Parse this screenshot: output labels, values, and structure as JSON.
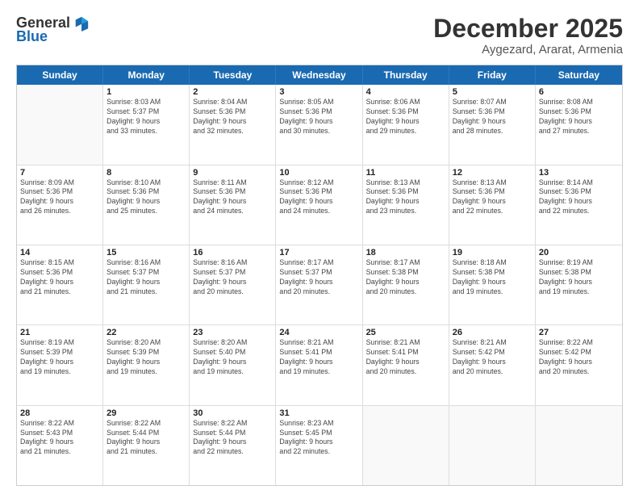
{
  "logo": {
    "general": "General",
    "blue": "Blue"
  },
  "title": "December 2025",
  "subtitle": "Aygezard, Ararat, Armenia",
  "days_header": [
    "Sunday",
    "Monday",
    "Tuesday",
    "Wednesday",
    "Thursday",
    "Friday",
    "Saturday"
  ],
  "weeks": [
    [
      {
        "num": "",
        "info": ""
      },
      {
        "num": "1",
        "info": "Sunrise: 8:03 AM\nSunset: 5:37 PM\nDaylight: 9 hours\nand 33 minutes."
      },
      {
        "num": "2",
        "info": "Sunrise: 8:04 AM\nSunset: 5:36 PM\nDaylight: 9 hours\nand 32 minutes."
      },
      {
        "num": "3",
        "info": "Sunrise: 8:05 AM\nSunset: 5:36 PM\nDaylight: 9 hours\nand 30 minutes."
      },
      {
        "num": "4",
        "info": "Sunrise: 8:06 AM\nSunset: 5:36 PM\nDaylight: 9 hours\nand 29 minutes."
      },
      {
        "num": "5",
        "info": "Sunrise: 8:07 AM\nSunset: 5:36 PM\nDaylight: 9 hours\nand 28 minutes."
      },
      {
        "num": "6",
        "info": "Sunrise: 8:08 AM\nSunset: 5:36 PM\nDaylight: 9 hours\nand 27 minutes."
      }
    ],
    [
      {
        "num": "7",
        "info": "Sunrise: 8:09 AM\nSunset: 5:36 PM\nDaylight: 9 hours\nand 26 minutes."
      },
      {
        "num": "8",
        "info": "Sunrise: 8:10 AM\nSunset: 5:36 PM\nDaylight: 9 hours\nand 25 minutes."
      },
      {
        "num": "9",
        "info": "Sunrise: 8:11 AM\nSunset: 5:36 PM\nDaylight: 9 hours\nand 24 minutes."
      },
      {
        "num": "10",
        "info": "Sunrise: 8:12 AM\nSunset: 5:36 PM\nDaylight: 9 hours\nand 24 minutes."
      },
      {
        "num": "11",
        "info": "Sunrise: 8:13 AM\nSunset: 5:36 PM\nDaylight: 9 hours\nand 23 minutes."
      },
      {
        "num": "12",
        "info": "Sunrise: 8:13 AM\nSunset: 5:36 PM\nDaylight: 9 hours\nand 22 minutes."
      },
      {
        "num": "13",
        "info": "Sunrise: 8:14 AM\nSunset: 5:36 PM\nDaylight: 9 hours\nand 22 minutes."
      }
    ],
    [
      {
        "num": "14",
        "info": "Sunrise: 8:15 AM\nSunset: 5:36 PM\nDaylight: 9 hours\nand 21 minutes."
      },
      {
        "num": "15",
        "info": "Sunrise: 8:16 AM\nSunset: 5:37 PM\nDaylight: 9 hours\nand 21 minutes."
      },
      {
        "num": "16",
        "info": "Sunrise: 8:16 AM\nSunset: 5:37 PM\nDaylight: 9 hours\nand 20 minutes."
      },
      {
        "num": "17",
        "info": "Sunrise: 8:17 AM\nSunset: 5:37 PM\nDaylight: 9 hours\nand 20 minutes."
      },
      {
        "num": "18",
        "info": "Sunrise: 8:17 AM\nSunset: 5:38 PM\nDaylight: 9 hours\nand 20 minutes."
      },
      {
        "num": "19",
        "info": "Sunrise: 8:18 AM\nSunset: 5:38 PM\nDaylight: 9 hours\nand 19 minutes."
      },
      {
        "num": "20",
        "info": "Sunrise: 8:19 AM\nSunset: 5:38 PM\nDaylight: 9 hours\nand 19 minutes."
      }
    ],
    [
      {
        "num": "21",
        "info": "Sunrise: 8:19 AM\nSunset: 5:39 PM\nDaylight: 9 hours\nand 19 minutes."
      },
      {
        "num": "22",
        "info": "Sunrise: 8:20 AM\nSunset: 5:39 PM\nDaylight: 9 hours\nand 19 minutes."
      },
      {
        "num": "23",
        "info": "Sunrise: 8:20 AM\nSunset: 5:40 PM\nDaylight: 9 hours\nand 19 minutes."
      },
      {
        "num": "24",
        "info": "Sunrise: 8:21 AM\nSunset: 5:41 PM\nDaylight: 9 hours\nand 19 minutes."
      },
      {
        "num": "25",
        "info": "Sunrise: 8:21 AM\nSunset: 5:41 PM\nDaylight: 9 hours\nand 20 minutes."
      },
      {
        "num": "26",
        "info": "Sunrise: 8:21 AM\nSunset: 5:42 PM\nDaylight: 9 hours\nand 20 minutes."
      },
      {
        "num": "27",
        "info": "Sunrise: 8:22 AM\nSunset: 5:42 PM\nDaylight: 9 hours\nand 20 minutes."
      }
    ],
    [
      {
        "num": "28",
        "info": "Sunrise: 8:22 AM\nSunset: 5:43 PM\nDaylight: 9 hours\nand 21 minutes."
      },
      {
        "num": "29",
        "info": "Sunrise: 8:22 AM\nSunset: 5:44 PM\nDaylight: 9 hours\nand 21 minutes."
      },
      {
        "num": "30",
        "info": "Sunrise: 8:22 AM\nSunset: 5:44 PM\nDaylight: 9 hours\nand 22 minutes."
      },
      {
        "num": "31",
        "info": "Sunrise: 8:23 AM\nSunset: 5:45 PM\nDaylight: 9 hours\nand 22 minutes."
      },
      {
        "num": "",
        "info": ""
      },
      {
        "num": "",
        "info": ""
      },
      {
        "num": "",
        "info": ""
      }
    ]
  ]
}
